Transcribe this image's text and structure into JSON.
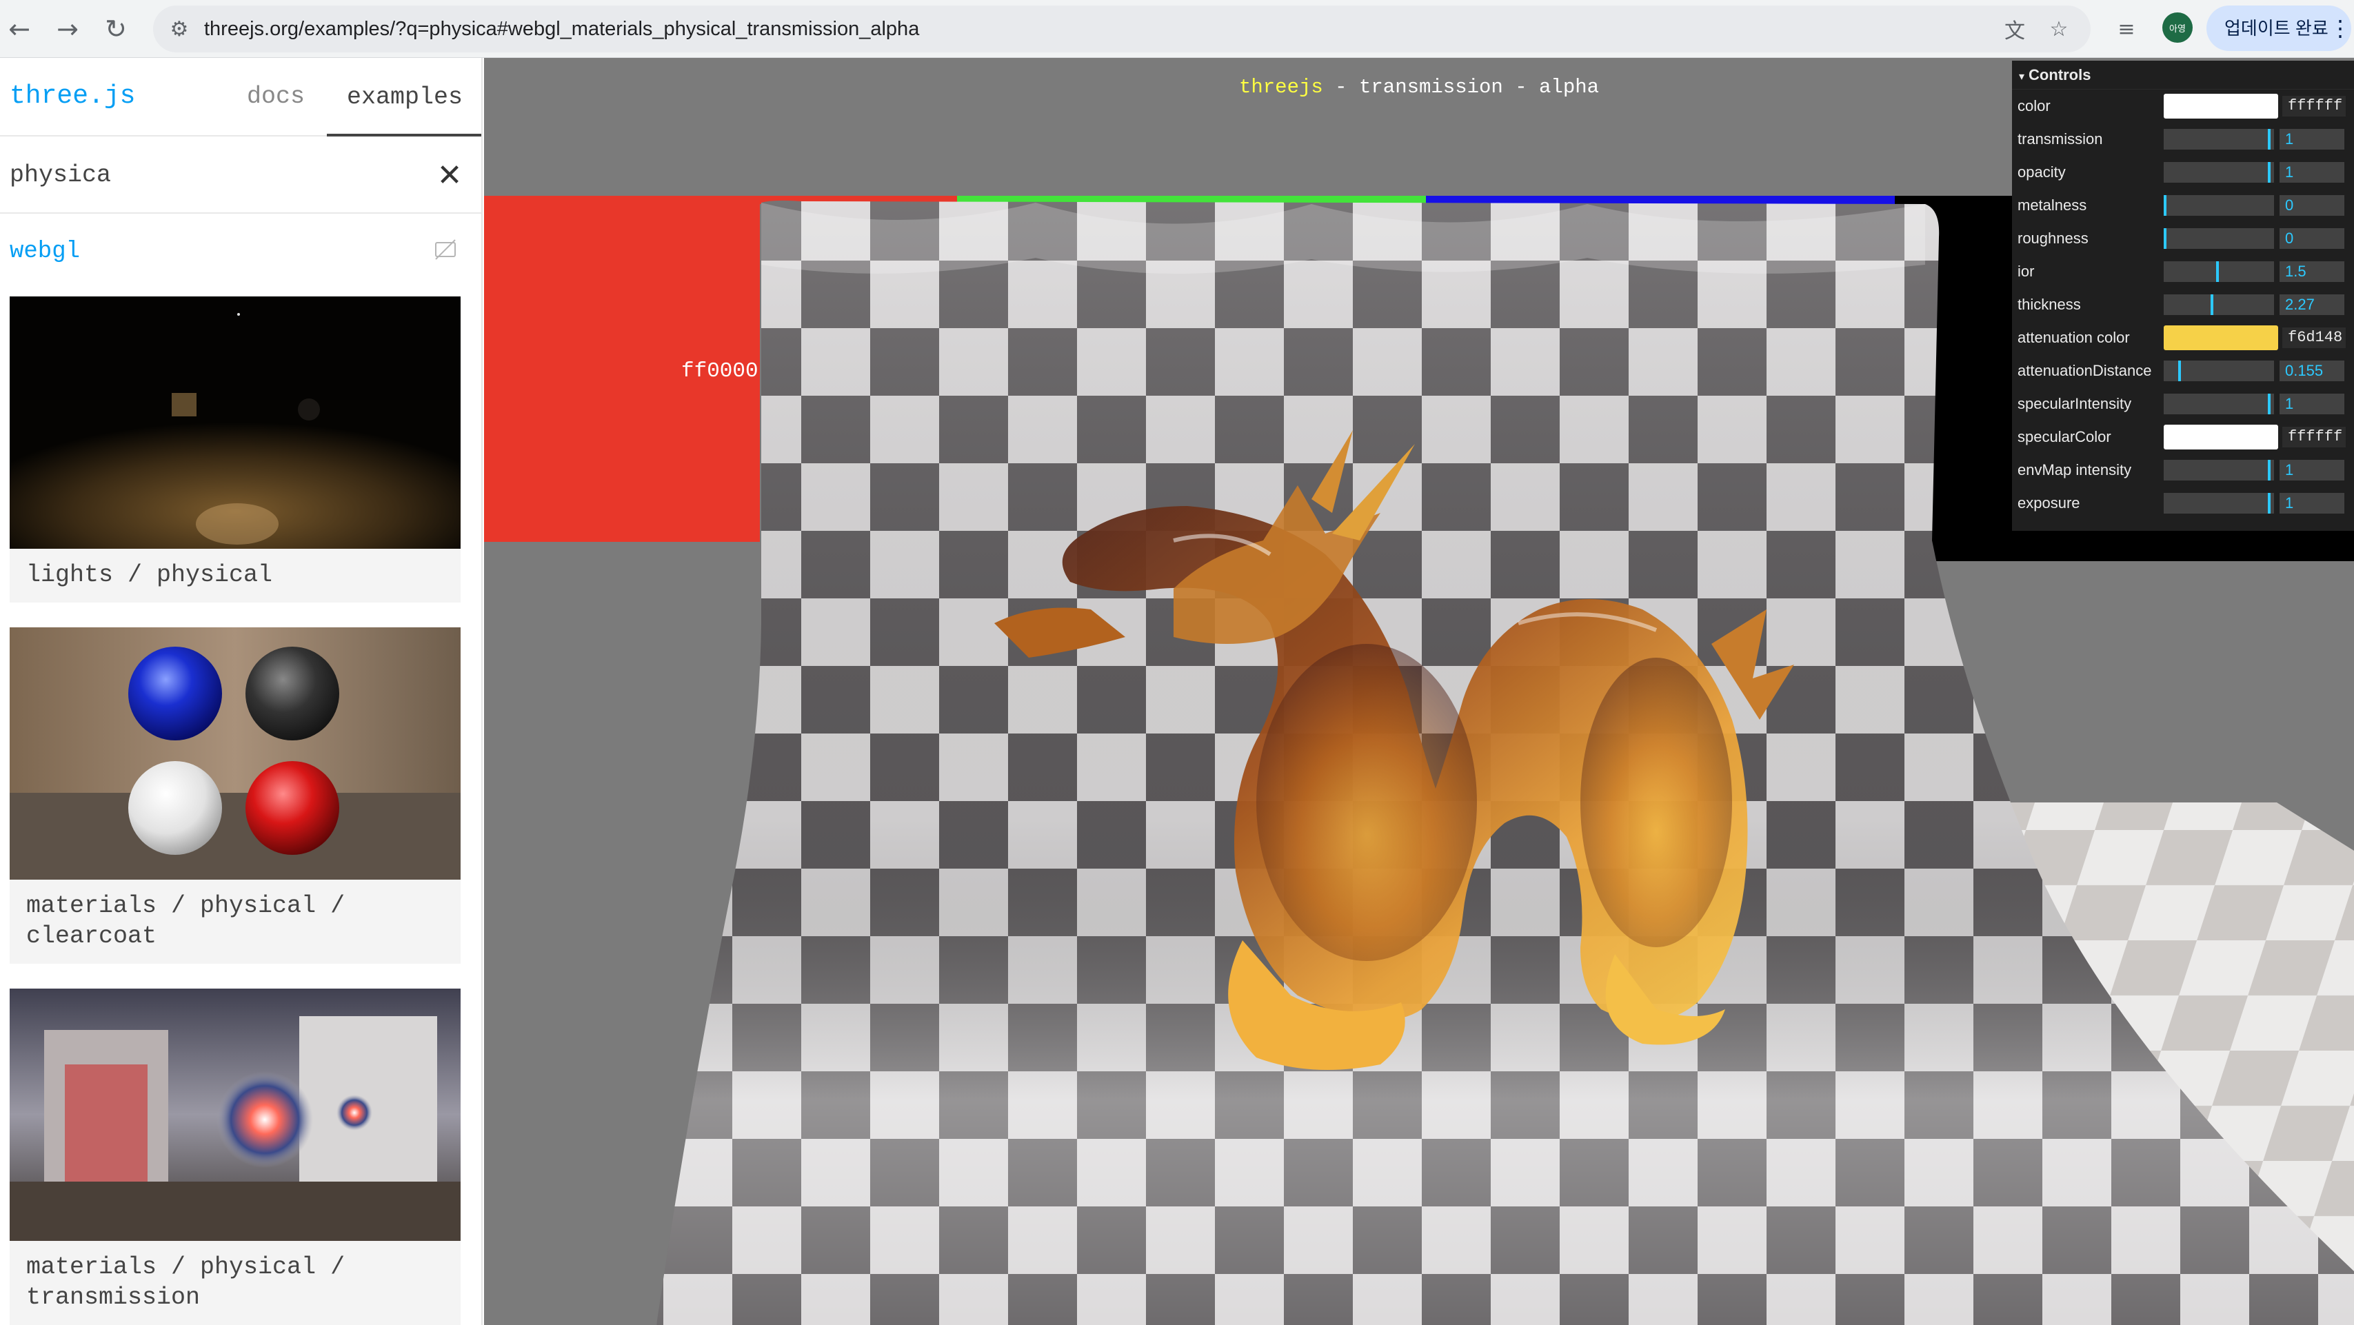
{
  "browser": {
    "url": "threejs.org/examples/?q=physica#webgl_materials_physical_transmission_alpha",
    "profile_initials": "아영",
    "update_label": "업데이트 완료"
  },
  "sidebar": {
    "logo": "three.js",
    "nav": {
      "docs": "docs",
      "examples": "examples"
    },
    "search_value": "physica",
    "category": "webgl",
    "cards": [
      {
        "title": "lights / physical"
      },
      {
        "title": "materials / physical /\nclearcoat"
      },
      {
        "title": "materials / physical /\ntransmission"
      }
    ]
  },
  "viewport": {
    "info_brand": "threejs",
    "info_rest": " - transmission - alpha",
    "backdrop_label": "ff0000"
  },
  "controls": {
    "title": "Controls",
    "rows": [
      {
        "label": "color",
        "kind": "color",
        "value": "ffffff",
        "color": "#ffffff"
      },
      {
        "label": "transmission",
        "kind": "slider",
        "value": "1",
        "fraction": 0.97
      },
      {
        "label": "opacity",
        "kind": "slider",
        "value": "1",
        "fraction": 0.97
      },
      {
        "label": "metalness",
        "kind": "slider",
        "value": "0",
        "fraction": 0.0
      },
      {
        "label": "roughness",
        "kind": "slider",
        "value": "0",
        "fraction": 0.0
      },
      {
        "label": "ior",
        "kind": "slider",
        "value": "1.5",
        "fraction": 0.5
      },
      {
        "label": "thickness",
        "kind": "slider",
        "value": "2.27",
        "fraction": 0.45
      },
      {
        "label": "attenuation color",
        "kind": "color",
        "value": "f6d148",
        "color": "#f6d148"
      },
      {
        "label": "attenuationDistance",
        "kind": "slider",
        "value": "0.155",
        "fraction": 0.155
      },
      {
        "label": "specularIntensity",
        "kind": "slider",
        "value": "1",
        "fraction": 0.97
      },
      {
        "label": "specularColor",
        "kind": "color",
        "value": "ffffff",
        "color": "#ffffff"
      },
      {
        "label": "envMap intensity",
        "kind": "slider",
        "value": "1",
        "fraction": 0.97
      },
      {
        "label": "exposure",
        "kind": "slider",
        "value": "1",
        "fraction": 0.97
      }
    ]
  }
}
